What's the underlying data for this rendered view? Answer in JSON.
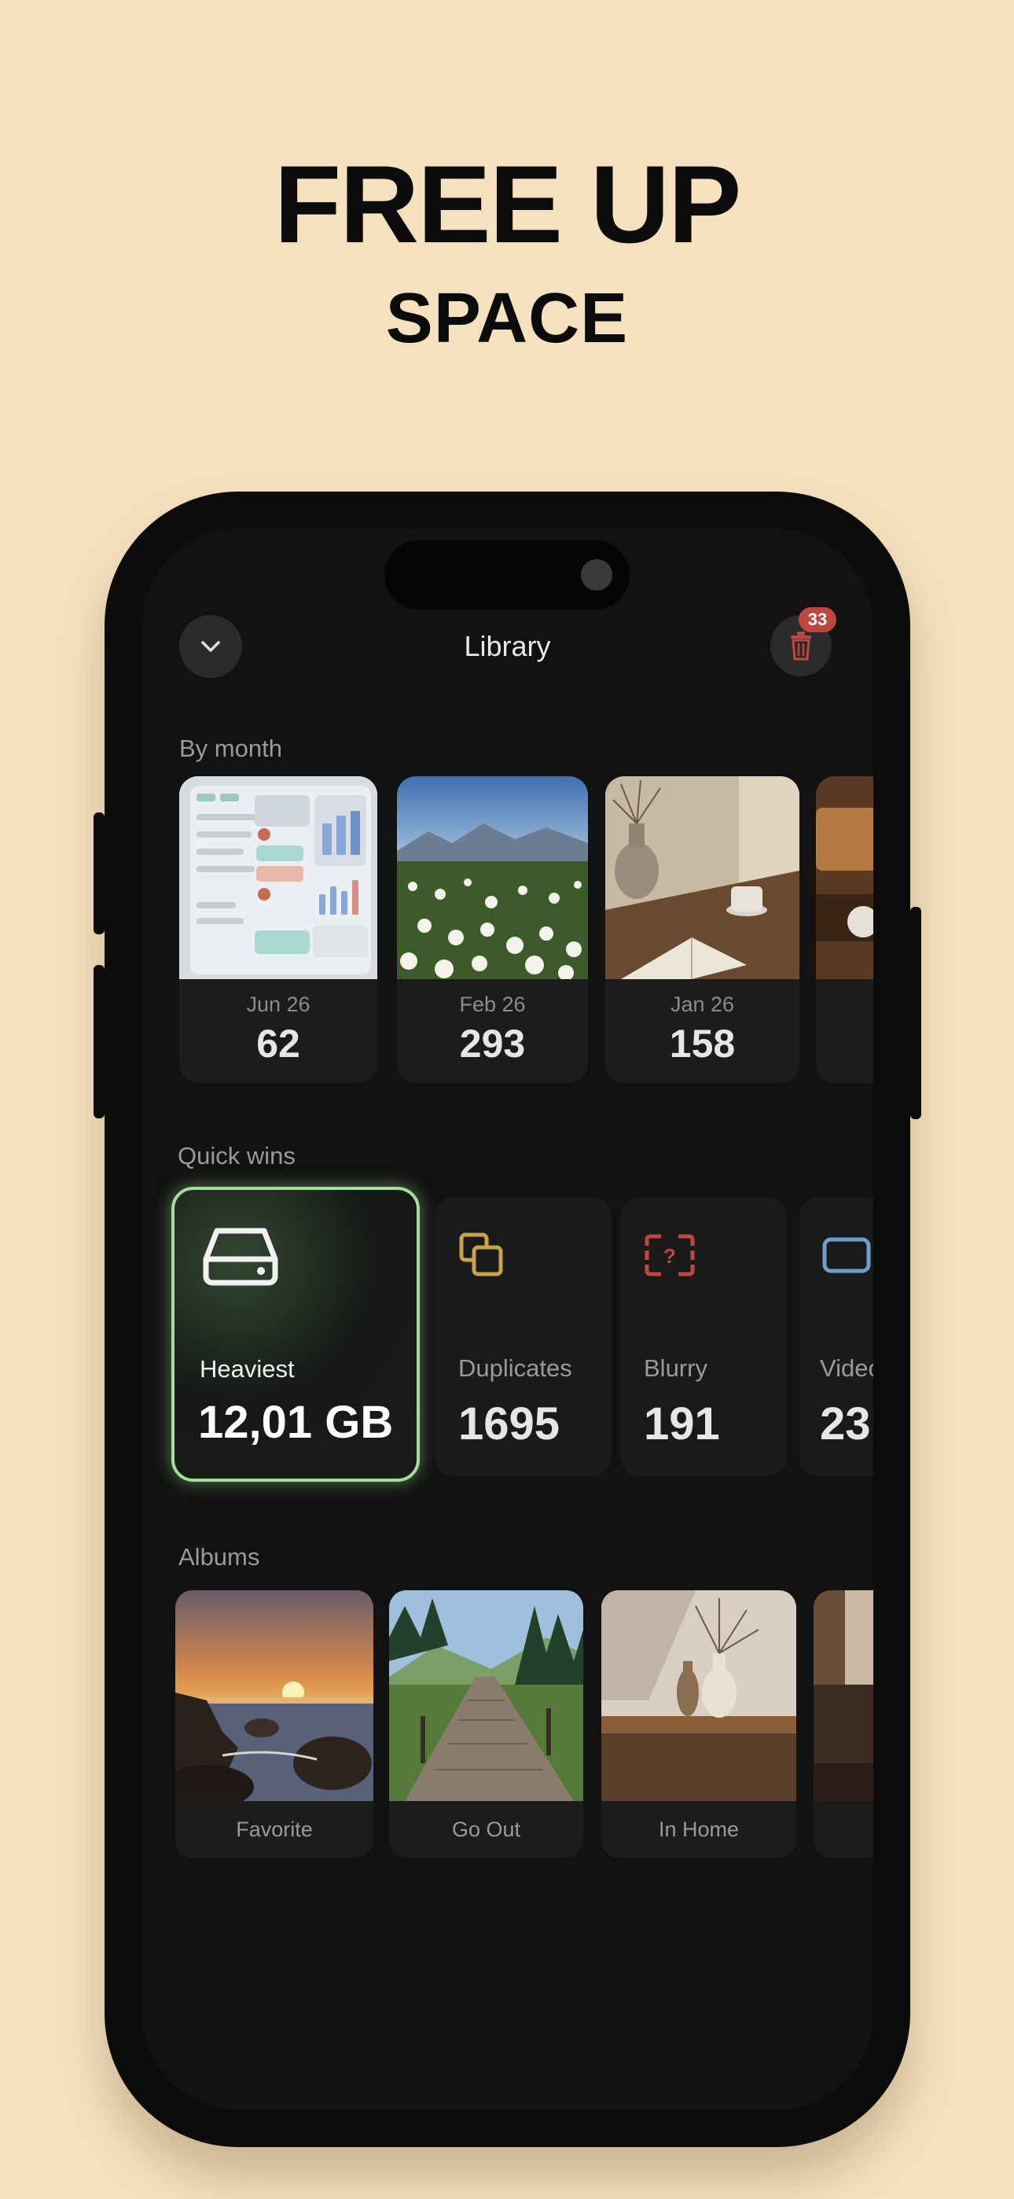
{
  "promo": {
    "headline": "FREE UP",
    "subheadline": "SPACE"
  },
  "header": {
    "title": "Library",
    "back_icon": "chevron-down-icon",
    "trash_icon": "trash-icon",
    "trash_badge": "33"
  },
  "by_month": {
    "label": "By month",
    "items": [
      {
        "date": "Jun 26",
        "count": "62"
      },
      {
        "date": "Feb 26",
        "count": "293"
      },
      {
        "date": "Jan 26",
        "count": "158"
      },
      {
        "date": "",
        "count": ""
      }
    ]
  },
  "quick_wins": {
    "label": "Quick wins",
    "items": [
      {
        "label": "Heaviest",
        "value": "12,01 GB",
        "icon": "hard-drive-icon",
        "accent": "#a8dba0"
      },
      {
        "label": "Duplicates",
        "value": "1695",
        "icon": "duplicate-icon",
        "accent": "#c9a24a"
      },
      {
        "label": "Blurry",
        "value": "191",
        "icon": "blurry-icon",
        "accent": "#c0473f"
      },
      {
        "label": "Videos",
        "value": "23",
        "icon": "video-icon",
        "accent": "#6f9fd0"
      }
    ]
  },
  "albums": {
    "label": "Albums",
    "items": [
      {
        "name": "Favorite"
      },
      {
        "name": "Go Out"
      },
      {
        "name": "In Home"
      },
      {
        "name": ""
      }
    ]
  },
  "colors": {
    "background": "#f6e1bf",
    "screen": "#121212",
    "card": "#1c1c1c",
    "badge": "#c0473f"
  }
}
